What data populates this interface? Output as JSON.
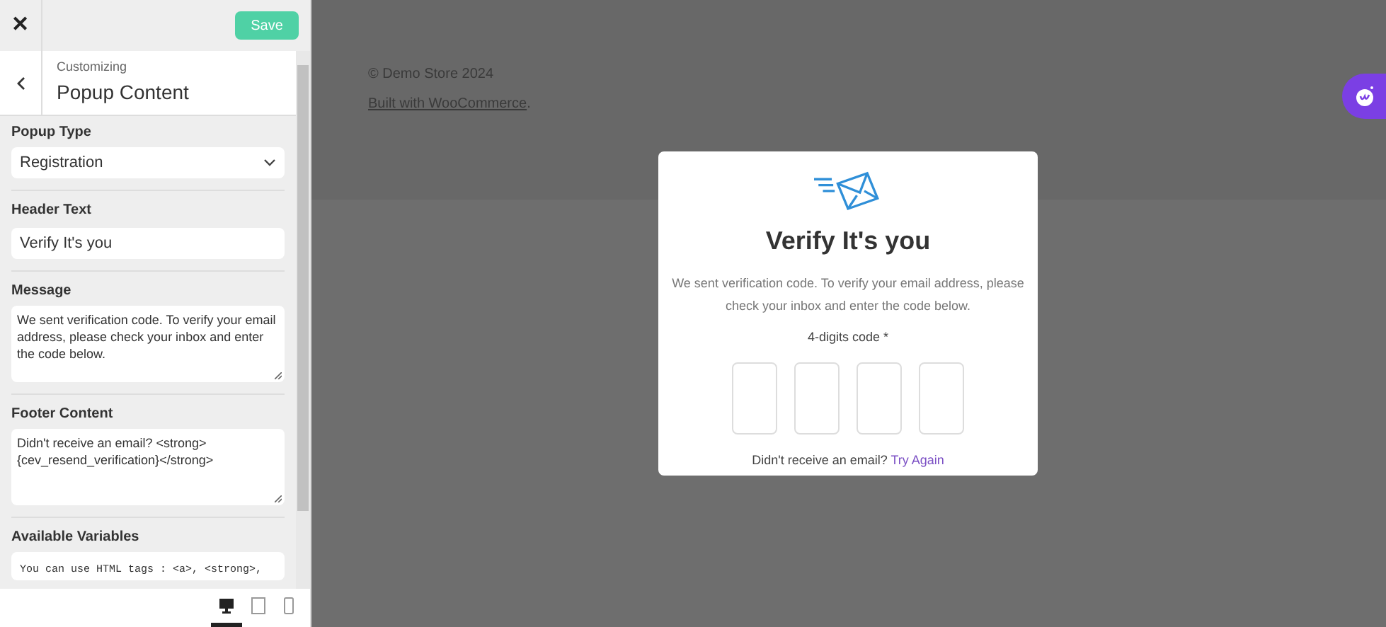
{
  "sidebar": {
    "close": "✕",
    "save_button": "Save",
    "breadcrumb": "Customizing",
    "title": "Popup Content",
    "fields": [
      {
        "kind": "select",
        "label": "Popup Type",
        "value": "Registration"
      },
      {
        "kind": "input",
        "label": "Header Text",
        "value": "Verify It's you"
      },
      {
        "kind": "textarea",
        "label": "Message",
        "value": "We sent verification code. To verify your email address, please check your inbox and enter the code below."
      },
      {
        "kind": "textarea",
        "label": "Footer Content",
        "value": "Didn't receive an email? <strong>{cev_resend_verification}</strong>"
      },
      {
        "kind": "code",
        "label": "Available Variables",
        "value": "You can use HTML tags : <a>, <strong>,"
      }
    ],
    "devices": [
      {
        "kind": "desktop",
        "selected": true
      },
      {
        "kind": "tablet",
        "selected": false
      },
      {
        "kind": "mobile",
        "selected": false
      }
    ]
  },
  "preview": {
    "copyright": "© Demo Store 2024",
    "built_with_link": "Built with WooCommerce",
    "built_with_end": ".",
    "popup": {
      "heading": "Verify It's you",
      "message": "We sent verification code. To verify your email address, please check your inbox and enter the code below.",
      "code_label": "4-digits code *",
      "digits": [
        {
          "filled": false
        },
        {
          "filled": false
        },
        {
          "filled": false
        },
        {
          "filled": false
        }
      ],
      "footer_text": "Didn't receive an email?",
      "footer_link": "Try Again"
    }
  }
}
